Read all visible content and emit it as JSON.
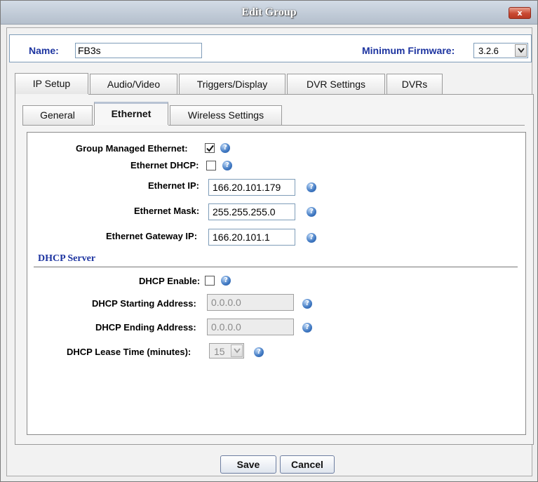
{
  "window": {
    "title": "Edit Group",
    "close_glyph": "x"
  },
  "header": {
    "name_label": "Name:",
    "name_value": "FB3s",
    "firmware_label": "Minimum Firmware:",
    "firmware_value": "3.2.6"
  },
  "main_tabs": [
    {
      "label": "IP Setup",
      "active": true
    },
    {
      "label": "Audio/Video",
      "active": false
    },
    {
      "label": "Triggers/Display",
      "active": false
    },
    {
      "label": "DVR Settings",
      "active": false
    },
    {
      "label": "DVRs",
      "active": false
    }
  ],
  "sub_tabs": [
    {
      "label": "General",
      "active": false
    },
    {
      "label": "Ethernet",
      "active": true
    },
    {
      "label": "Wireless Settings",
      "active": false
    }
  ],
  "ethernet": {
    "group_managed_label": "Group Managed Ethernet:",
    "group_managed_checked": true,
    "dhcp_label": "Ethernet DHCP:",
    "dhcp_checked": false,
    "ip_label": "Ethernet IP:",
    "ip_value": "166.20.101.179",
    "mask_label": "Ethernet Mask:",
    "mask_value": "255.255.255.0",
    "gateway_label": "Ethernet Gateway IP:",
    "gateway_value": "166.20.101.1"
  },
  "dhcp_server": {
    "section_title": "DHCP Server",
    "enable_label": "DHCP Enable:",
    "enable_checked": false,
    "start_label": "DHCP Starting Address:",
    "start_value": "0.0.0.0",
    "end_label": "DHCP Ending Address:",
    "end_value": "0.0.0.0",
    "lease_label": "DHCP Lease Time (minutes):",
    "lease_value": "15"
  },
  "help_glyph": "?",
  "buttons": {
    "save": "Save",
    "cancel": "Cancel"
  },
  "icons": {
    "close": "close-icon",
    "help": "help-icon",
    "dropdown": "chevron-down-icon",
    "check": "checkmark-icon"
  },
  "colors": {
    "label_blue": "#1d34a0",
    "help_blue": "#3f78c2",
    "close_red": "#c94a33"
  }
}
